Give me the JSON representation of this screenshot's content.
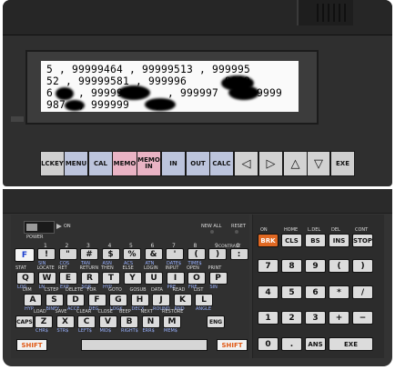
{
  "display": {
    "lines": [
      "5 , 99999464 , 99999513 , 999995",
      "52 , 99999581 , 999996      9999",
      "6    , 999997      , 999997    , 9999",
      "987  , 999999    ,"
    ]
  },
  "function_keys": [
    {
      "label": "LCKEY",
      "style": "plain"
    },
    {
      "label": "MENU",
      "style": "blue"
    },
    {
      "label": "CAL",
      "style": "blue"
    },
    {
      "label": "MEMO",
      "style": "pink"
    },
    {
      "label": "MEMO IN",
      "style": "pink"
    },
    {
      "label": "IN",
      "style": "blue"
    },
    {
      "label": "OUT",
      "style": "blue"
    },
    {
      "label": "CALC",
      "style": "blue"
    },
    {
      "label": "◁",
      "style": "arrow"
    },
    {
      "label": "▷",
      "style": "arrow"
    },
    {
      "label": "△",
      "style": "arrow"
    },
    {
      "label": "▽",
      "style": "arrow"
    },
    {
      "label": "EXE",
      "style": "plain"
    }
  ],
  "power": {
    "label": "POWER",
    "on_label": "ON"
  },
  "status_leds": {
    "newall": "NEW ALL",
    "reset": "RESET"
  },
  "contrast_label": "CONTRAST",
  "f_key": "F",
  "number_row": {
    "keys": [
      "!",
      "\"",
      "#",
      "$",
      "%",
      "&",
      "'",
      "(",
      ")",
      ":"
    ],
    "above": [
      "1",
      "2",
      "3",
      "4",
      "5",
      "6",
      "7",
      "8",
      "9",
      "0"
    ],
    "below": [
      "SIN",
      "COS",
      "TAN",
      "ASN",
      "ACS",
      "ATN",
      "DATE$",
      "TIME$",
      "",
      ""
    ]
  },
  "rows": {
    "qwerty": {
      "keys": [
        "Q",
        "W",
        "E",
        "R",
        "T",
        "Y",
        "U",
        "I",
        "O",
        "P"
      ],
      "above": [
        "STAT",
        "LOCATE",
        "RET",
        "RETURN",
        "THEN",
        "ELSE",
        "LOGIN",
        "INPUT",
        "OPEN",
        "PRINT"
      ],
      "below": [
        "LOG",
        "LN",
        "EXP",
        "SQR",
        "HYP",
        "",
        "",
        "PRE",
        "FRE",
        "SIN"
      ]
    },
    "asdf": {
      "keys": [
        "A",
        "S",
        "D",
        "F",
        "G",
        "H",
        "J",
        "K",
        "L"
      ],
      "above": [
        "DIM",
        "CSTEP",
        "DELETE",
        "FOR",
        "GOTO",
        "GOSUB",
        "DATA",
        "READ",
        "LIST"
      ],
      "below": [
        "HYP",
        "BINFY",
        "ACCF",
        "DEG",
        "LOGK",
        "DECX",
        "ROUND",
        "RND",
        "ANGLE"
      ]
    },
    "zxcv": {
      "keys": [
        "Z",
        "X",
        "C",
        "V",
        "B",
        "N",
        "M"
      ],
      "above": [
        "LOAD",
        "SAVE",
        "CLEAR",
        "CLOSE",
        "BEEP",
        "NEXT",
        "RESTORE"
      ],
      "below": [
        "CHR$",
        "STR$",
        "LEFT$",
        "MID$",
        "RIGHT$",
        "ERR$",
        "MEM$"
      ],
      "caps": "CAPS",
      "eng": "ENG"
    }
  },
  "shift_label": "SHIFT",
  "keypad": {
    "top": [
      {
        "label": "BRK",
        "above": "ON",
        "style": "orange"
      },
      {
        "label": "CLS",
        "above": "HOME"
      },
      {
        "label": "BS",
        "above": "L.DEL"
      },
      {
        "label": "INS",
        "above": "DEL"
      },
      {
        "label": "STOP",
        "above": "CONT"
      }
    ],
    "rows": [
      [
        {
          "label": "7"
        },
        {
          "label": "8"
        },
        {
          "label": "9"
        },
        {
          "label": "("
        },
        {
          "label": ")"
        }
      ],
      [
        {
          "label": "4"
        },
        {
          "label": "5"
        },
        {
          "label": "6"
        },
        {
          "label": "*"
        },
        {
          "label": "/"
        }
      ],
      [
        {
          "label": "1"
        },
        {
          "label": "2"
        },
        {
          "label": "3"
        },
        {
          "label": "+"
        },
        {
          "label": "−"
        }
      ],
      [
        {
          "label": "0"
        },
        {
          "label": "."
        },
        {
          "label": "ANS"
        },
        {
          "label": "EXE",
          "wide": true
        }
      ]
    ]
  }
}
